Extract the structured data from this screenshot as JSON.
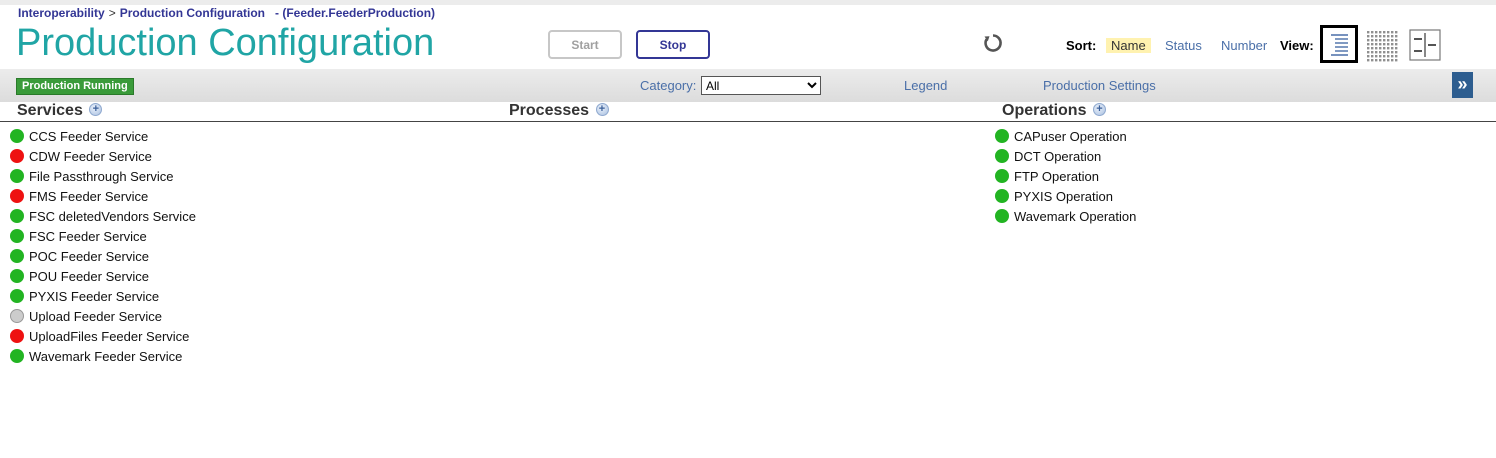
{
  "breadcrumb": {
    "root": "Interoperability",
    "separator": ">",
    "current": "Production Configuration",
    "context": "- (Feeder.FeederProduction)"
  },
  "page_title": "Production Configuration",
  "buttons": {
    "start": "Start",
    "stop": "Stop"
  },
  "sort": {
    "label": "Sort:",
    "options": [
      "Name",
      "Status",
      "Number"
    ],
    "selected": "Name"
  },
  "view": {
    "label": "View:",
    "modes": [
      "list-view-icon",
      "grid-view-icon",
      "split-view-icon"
    ],
    "selected": "list-view-icon"
  },
  "toolbar": {
    "status_badge": "Production Running",
    "category_label": "Category:",
    "category_value": "All",
    "legend_link": "Legend",
    "settings_link": "Production Settings",
    "expand_label": "»"
  },
  "columns": {
    "services": "Services",
    "processes": "Processes",
    "operations": "Operations"
  },
  "status_colors": {
    "running": "#22b422",
    "error": "#ee1111",
    "disabled": "#cccccc"
  },
  "services": [
    {
      "name": "CCS Feeder Service",
      "status": "running"
    },
    {
      "name": "CDW Feeder Service",
      "status": "error"
    },
    {
      "name": "File Passthrough Service",
      "status": "running"
    },
    {
      "name": "FMS Feeder Service",
      "status": "error"
    },
    {
      "name": "FSC deletedVendors Service",
      "status": "running"
    },
    {
      "name": "FSC Feeder Service",
      "status": "running"
    },
    {
      "name": "POC Feeder Service",
      "status": "running"
    },
    {
      "name": "POU Feeder Service",
      "status": "running"
    },
    {
      "name": "PYXIS Feeder Service",
      "status": "running"
    },
    {
      "name": "Upload Feeder Service",
      "status": "disabled"
    },
    {
      "name": "UploadFiles Feeder Service",
      "status": "error"
    },
    {
      "name": "Wavemark Feeder Service",
      "status": "running"
    }
  ],
  "processes": [],
  "operations": [
    {
      "name": "CAPuser Operation",
      "status": "running"
    },
    {
      "name": "DCT Operation",
      "status": "running"
    },
    {
      "name": "FTP Operation",
      "status": "running"
    },
    {
      "name": "PYXIS Operation",
      "status": "running"
    },
    {
      "name": "Wavemark Operation",
      "status": "running"
    }
  ]
}
